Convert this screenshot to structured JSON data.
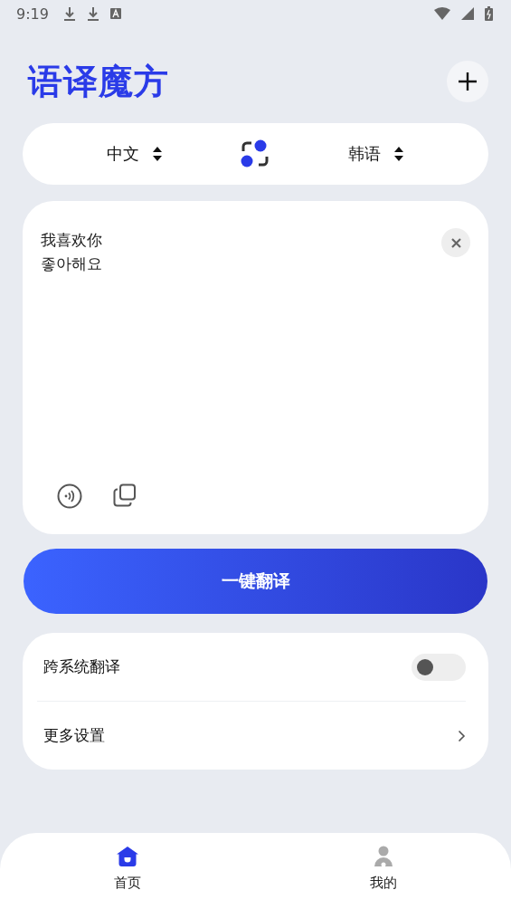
{
  "status_bar": {
    "time": "9:19"
  },
  "header": {
    "title": "语译魔方"
  },
  "languages": {
    "source": "中文",
    "target": "韩语"
  },
  "input": {
    "value": "我喜欢你\n좋아해요"
  },
  "translate_button": "一键翻译",
  "settings": [
    {
      "kind": "toggle",
      "label": "跨系统翻译",
      "on": false
    },
    {
      "kind": "link",
      "label": "更多设置"
    }
  ],
  "nav": [
    {
      "label": "首页",
      "selected": true
    },
    {
      "label": "我的",
      "selected": false
    }
  ]
}
